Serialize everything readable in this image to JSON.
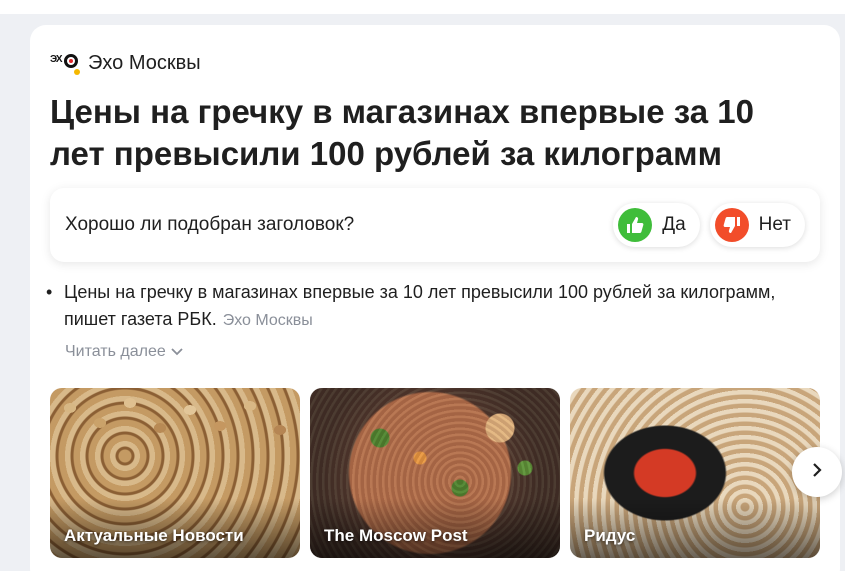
{
  "source": {
    "name": "Эхо Москвы",
    "logo_icon": "echo-moskvy-logo"
  },
  "headline": "Цены на гречку в магазинах впервые за 10 лет превысили 100 рублей за килограмм",
  "feedback": {
    "question": "Хорошо ли подобран заголовок?",
    "yes_label": "Да",
    "no_label": "Нет",
    "yes_icon": "thumbs-up-icon",
    "no_icon": "thumbs-down-icon",
    "yes_color": "#3fbd3a",
    "no_color": "#f24d2a"
  },
  "summary": {
    "text": "Цены на гречку в магазинах впервые за 10 лет превысили 100 рублей за килограмм, пишет газета РБК.",
    "source": "Эхо Москвы"
  },
  "read_more": {
    "label": "Читать далее",
    "icon": "chevron-down-icon"
  },
  "related": [
    {
      "caption": "Актуальные Новости"
    },
    {
      "caption": "The Moscow Post"
    },
    {
      "caption": "Ридус"
    }
  ],
  "next_icon": "chevron-right-icon"
}
